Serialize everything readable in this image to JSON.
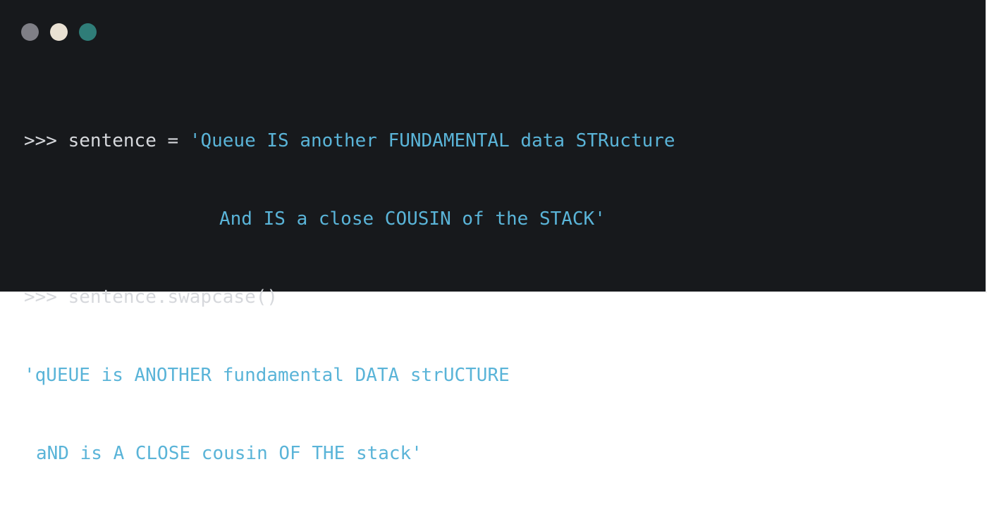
{
  "window": {
    "dots": [
      {
        "name": "close",
        "color": "#7f7f86"
      },
      {
        "name": "minimize",
        "color": "#e9e1d3"
      },
      {
        "name": "maximize",
        "color": "#2f7d78"
      }
    ]
  },
  "console": {
    "line1_prompt": ">>>",
    "line1_code": "sentence = ",
    "line1_string": "'Queue IS another FUNDAMENTAL data STRucture",
    "line2_string": "And IS a close COUSIN of the STACK'",
    "line3_prompt": ">>>",
    "line3_code": "sentence.swapcase()",
    "line4_output": "'qUEUE is ANOTHER fundamental DATA strUCTURE",
    "line5_output": "aND is A CLOSE cousin OF THE stack'"
  },
  "colors": {
    "background": "#17191c",
    "text": "#d6d8dc",
    "string": "#5ab4d8"
  }
}
